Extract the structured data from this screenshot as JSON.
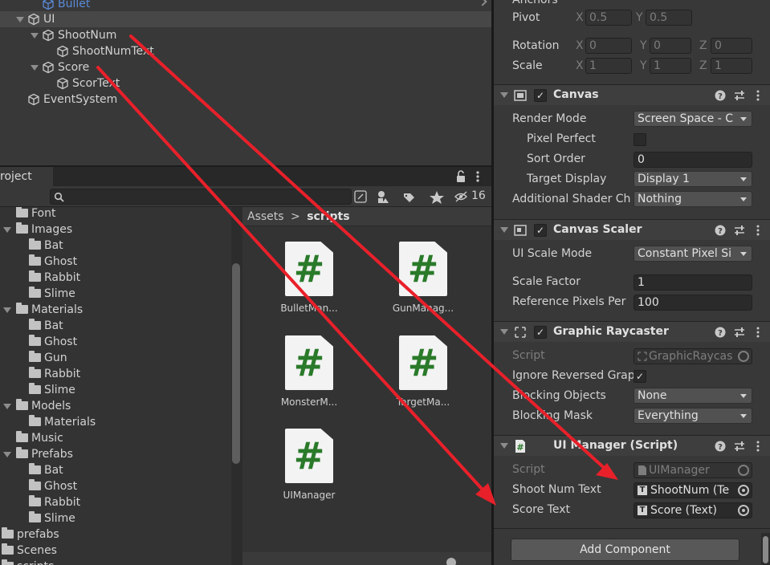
{
  "hierarchy": {
    "items": [
      {
        "label": "Bullet",
        "depth": 2,
        "fold": false,
        "highlight_blue": true
      },
      {
        "label": "UI",
        "depth": 1,
        "fold": true,
        "selected": true
      },
      {
        "label": "ShootNum",
        "depth": 2,
        "fold": true
      },
      {
        "label": "ShootNumText",
        "depth": 3,
        "fold": false
      },
      {
        "label": "Score",
        "depth": 2,
        "fold": true
      },
      {
        "label": "ScorText",
        "depth": 3,
        "fold": false
      },
      {
        "label": "EventSystem",
        "depth": 1,
        "fold": false
      }
    ]
  },
  "project": {
    "tab_label": "roject",
    "hidden_count": "16",
    "tree": [
      {
        "label": "Font",
        "depth": 1,
        "fold": false
      },
      {
        "label": "Images",
        "depth": 0,
        "fold": true
      },
      {
        "label": "Bat",
        "depth": 2,
        "fold": false
      },
      {
        "label": "Ghost",
        "depth": 2,
        "fold": false
      },
      {
        "label": "Rabbit",
        "depth": 2,
        "fold": false
      },
      {
        "label": "Slime",
        "depth": 2,
        "fold": false
      },
      {
        "label": "Materials",
        "depth": 0,
        "fold": true
      },
      {
        "label": "Bat",
        "depth": 2,
        "fold": false
      },
      {
        "label": "Ghost",
        "depth": 2,
        "fold": false
      },
      {
        "label": "Gun",
        "depth": 2,
        "fold": false
      },
      {
        "label": "Rabbit",
        "depth": 2,
        "fold": false
      },
      {
        "label": "Slime",
        "depth": 2,
        "fold": false
      },
      {
        "label": "Models",
        "depth": 0,
        "fold": true
      },
      {
        "label": "Materials",
        "depth": 2,
        "fold": false
      },
      {
        "label": "Music",
        "depth": 1,
        "fold": false
      },
      {
        "label": "Prefabs",
        "depth": 0,
        "fold": true
      },
      {
        "label": "Bat",
        "depth": 2,
        "fold": false
      },
      {
        "label": "Ghost",
        "depth": 2,
        "fold": false
      },
      {
        "label": "Rabbit",
        "depth": 2,
        "fold": false
      },
      {
        "label": "Slime",
        "depth": 2,
        "fold": false
      },
      {
        "label": "prefabs",
        "depth": -1,
        "fold": false
      },
      {
        "label": "Scenes",
        "depth": -1,
        "fold": false
      },
      {
        "label": "scripts",
        "depth": -1,
        "fold": false
      }
    ],
    "breadcrumb": {
      "root": "Assets",
      "separator": ">",
      "current": "scripts"
    },
    "assets": [
      {
        "label": "BulletMan...",
        "icon": "csharp-script-icon"
      },
      {
        "label": "GunManag...",
        "icon": "csharp-script-icon"
      },
      {
        "label": "MonsterM...",
        "icon": "csharp-script-icon"
      },
      {
        "label": "TargetMa...",
        "icon": "csharp-script-icon"
      },
      {
        "label": "UIManager",
        "icon": "csharp-script-icon"
      }
    ],
    "script_glyph": "#"
  },
  "inspector": {
    "anchors_label": "Anchors",
    "pivot": {
      "label": "Pivot",
      "x_axis": "X",
      "x": "0.5",
      "y_axis": "Y",
      "y": "0.5"
    },
    "rotation": {
      "label": "Rotation",
      "x_axis": "X",
      "x": "0",
      "y_axis": "Y",
      "y": "0",
      "z_axis": "Z",
      "z": "0"
    },
    "scale": {
      "label": "Scale",
      "x_axis": "X",
      "x": "1",
      "y_axis": "Y",
      "y": "1",
      "z_axis": "Z",
      "z": "1"
    },
    "canvas": {
      "title": "Canvas",
      "enabled_mark": "✓",
      "render_mode_label": "Render Mode",
      "render_mode_value": "Screen Space - C",
      "pixel_perfect_label": "Pixel Perfect",
      "sort_order_label": "Sort Order",
      "sort_order_value": "0",
      "target_display_label": "Target Display",
      "target_display_value": "Display 1",
      "shader_label": "Additional Shader Ch",
      "shader_value": "Nothing"
    },
    "canvas_scaler": {
      "title": "Canvas Scaler",
      "enabled_mark": "✓",
      "ui_scale_mode_label": "UI Scale Mode",
      "ui_scale_mode_value": "Constant Pixel Si",
      "scale_factor_label": "Scale Factor",
      "scale_factor_value": "1",
      "ref_ppu_label": "Reference Pixels Per",
      "ref_ppu_value": "100"
    },
    "graphic_raycaster": {
      "title": "Graphic Raycaster",
      "enabled_mark": "✓",
      "script_label": "Script",
      "script_value": "GraphicRaycas",
      "ignore_label": "Ignore Reversed Grap",
      "ignore_mark": "✓",
      "blocking_objects_label": "Blocking Objects",
      "blocking_objects_value": "None",
      "blocking_mask_label": "Blocking Mask",
      "blocking_mask_value": "Everything"
    },
    "ui_manager": {
      "title": "UI Manager (Script)",
      "script_label": "Script",
      "script_value": "UIManager",
      "shoot_num_label": "Shoot Num Text",
      "shoot_num_value": "ShootNum (Te",
      "score_label": "Score Text",
      "score_value": "Score (Text)",
      "text_icon_glyph": "T"
    },
    "add_component_label": "Add Component"
  },
  "annotation_colors": {
    "arrow": "#e8202a"
  }
}
